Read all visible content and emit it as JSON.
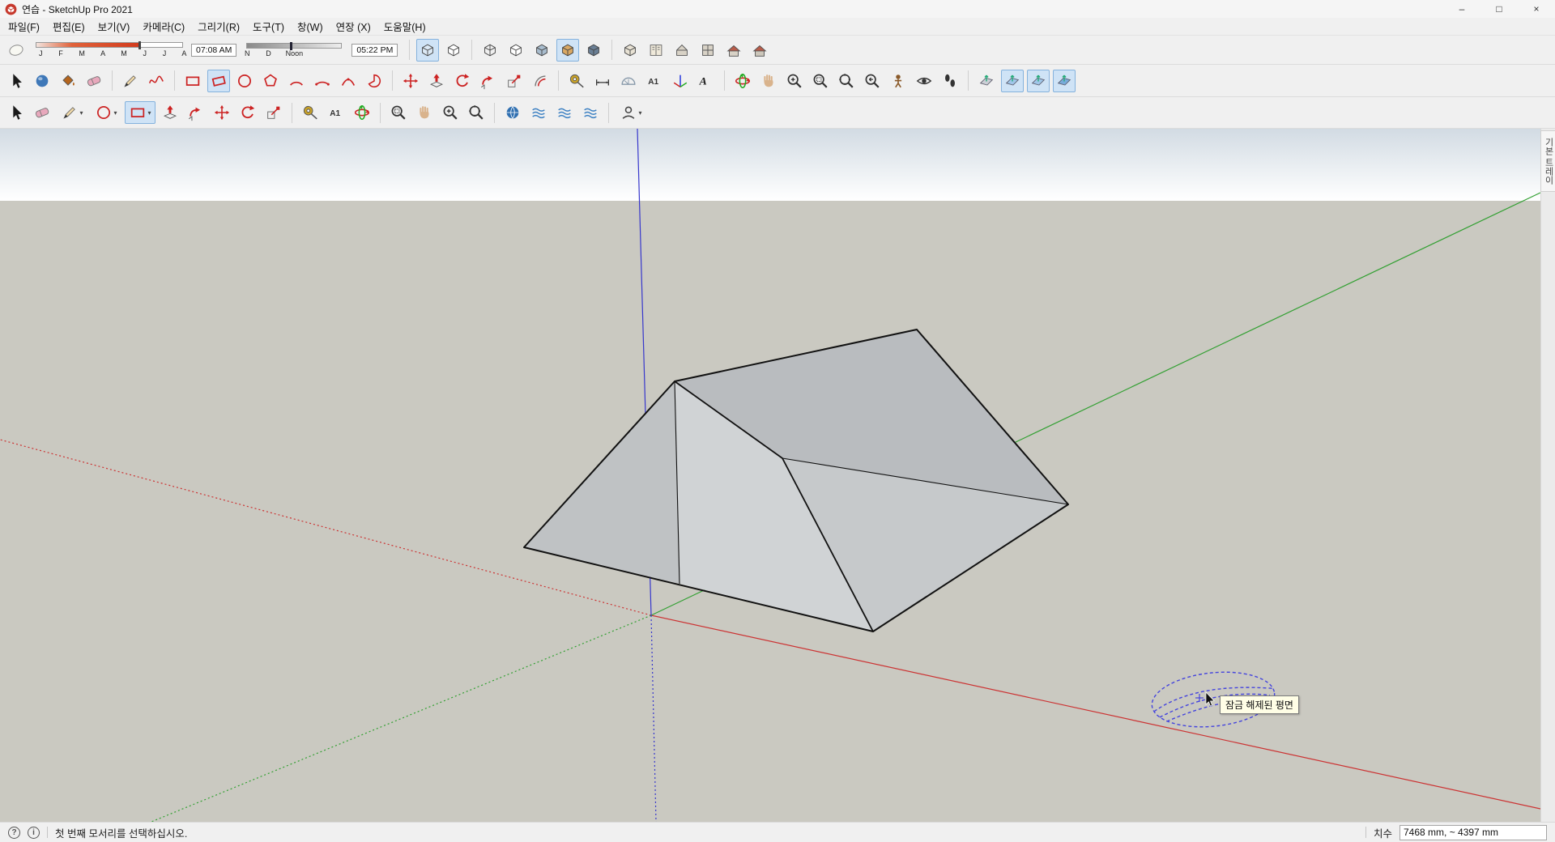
{
  "window": {
    "title": "연습 - SketchUp Pro 2021",
    "controls": {
      "minimize": "–",
      "maximize": "□",
      "close": "×"
    }
  },
  "menubar": {
    "items": [
      {
        "key": "file",
        "label": "파일(F)"
      },
      {
        "key": "edit",
        "label": "편집(E)"
      },
      {
        "key": "view",
        "label": "보기(V)"
      },
      {
        "key": "camera",
        "label": "카메라(C)"
      },
      {
        "key": "draw",
        "label": "그리기(R)"
      },
      {
        "key": "tools",
        "label": "도구(T)"
      },
      {
        "key": "window",
        "label": "창(W)"
      },
      {
        "key": "extensions",
        "label": "연장 (X)"
      },
      {
        "key": "help",
        "label": "도움말(H)"
      }
    ]
  },
  "shadow_toolbar": {
    "months_label": "J F M A M J J A S O N D",
    "time_start": "07:08 AM",
    "time_noon": "Noon",
    "time_end": "05:22 PM"
  },
  "toolbars": {
    "row1_left": [
      {
        "name": "shadow-toggle",
        "shape": "blob",
        "color": "#f8f8f2"
      }
    ],
    "row1_styles": [
      {
        "sep": true
      },
      {
        "name": "style-xray",
        "shape": "cube",
        "color": "#dce9f5",
        "active": true
      },
      {
        "name": "style-back-edges",
        "shape": "cube",
        "color": "#ffffff"
      },
      {
        "sep": true
      },
      {
        "name": "style-wireframe",
        "shape": "cubewire",
        "color": "#ffffff"
      },
      {
        "name": "style-hidden-line",
        "shape": "cube",
        "color": "#ffffff"
      },
      {
        "name": "style-shaded",
        "shape": "cube",
        "color": "#a8bccd"
      },
      {
        "name": "style-shaded-textures",
        "shape": "cube",
        "color": "#d9a864",
        "active": true
      },
      {
        "name": "style-monochrome",
        "shape": "cube",
        "color": "#6a7f95"
      },
      {
        "sep": true
      }
    ],
    "row1_views": [
      {
        "name": "scene-box-icon",
        "shape": "cube",
        "color": "#e8e2d4"
      },
      {
        "name": "pages-icon",
        "shape": "book",
        "color": "#efe9da"
      },
      {
        "name": "view-iso",
        "shape": "house",
        "color": "#d8d2c6"
      },
      {
        "name": "view-top",
        "shape": "housetop",
        "color": "#d8d2c6"
      },
      {
        "name": "view-front",
        "shape": "housefront",
        "color": "#d8d2c6"
      },
      {
        "name": "view-back",
        "shape": "housefront",
        "color": "#ccc6ba"
      }
    ],
    "row2": [
      {
        "name": "select-tool",
        "shape": "cursor",
        "color": "#1a1a1a"
      },
      {
        "name": "make-component-tool",
        "shape": "orb",
        "color": "#3f78b8"
      },
      {
        "name": "paint-bucket-tool",
        "shape": "bucket",
        "color": "#b5651d"
      },
      {
        "name": "eraser-tool",
        "shape": "eraser",
        "color": "#e8a8bc"
      },
      {
        "sep": true
      },
      {
        "name": "line-tool",
        "shape": "pencil",
        "color": "#333333"
      },
      {
        "name": "freehand-tool",
        "shape": "squiggle",
        "color": "#cc2222"
      },
      {
        "sep": true
      },
      {
        "name": "rectangle-tool",
        "shape": "rect",
        "color": "#cc2222"
      },
      {
        "name": "rotated-rectangle-tool",
        "shape": "rrect",
        "color": "#cc2222",
        "active": true
      },
      {
        "name": "circle-tool",
        "shape": "circle",
        "color": "#cc2222"
      },
      {
        "name": "polygon-tool",
        "shape": "polygon",
        "color": "#cc2222"
      },
      {
        "name": "arc-tool",
        "shape": "arc",
        "color": "#cc2222"
      },
      {
        "name": "two-point-arc-tool",
        "shape": "arc2",
        "color": "#cc2222"
      },
      {
        "name": "three-point-arc-tool",
        "shape": "arc3",
        "color": "#cc2222"
      },
      {
        "name": "pie-tool",
        "shape": "pie",
        "color": "#cc2222"
      },
      {
        "sep": true
      },
      {
        "name": "move-tool",
        "shape": "move",
        "color": "#cc2222"
      },
      {
        "name": "push-pull-tool",
        "shape": "pushpull",
        "color": "#cc2222"
      },
      {
        "name": "rotate-tool",
        "shape": "rotate",
        "color": "#cc2222"
      },
      {
        "name": "follow-me-tool",
        "shape": "followme",
        "color": "#cc2222"
      },
      {
        "name": "scale-tool",
        "shape": "scale",
        "color": "#cc2222"
      },
      {
        "name": "offset-tool",
        "shape": "offset",
        "color": "#cc2222"
      },
      {
        "sep": true
      },
      {
        "name": "tape-measure-tool",
        "shape": "tape",
        "color": "#c9a227"
      },
      {
        "name": "dimension-tool",
        "shape": "dim",
        "color": "#333333"
      },
      {
        "name": "protractor-tool",
        "shape": "protractor",
        "color": "#8899aa"
      },
      {
        "name": "text-tool",
        "shape": "textA",
        "color": "#333333"
      },
      {
        "name": "axes-tool",
        "shape": "axes",
        "color": "#cc2222"
      },
      {
        "name": "3d-text-tool",
        "shape": "text3d",
        "color": "#222222"
      },
      {
        "sep": true
      },
      {
        "name": "orbit-tool",
        "shape": "orbit",
        "color": "#cc2222"
      },
      {
        "name": "pan-tool",
        "shape": "hand",
        "color": "#d9b38c"
      },
      {
        "name": "zoom-tool",
        "shape": "zoomplus",
        "color": "#333333"
      },
      {
        "name": "zoom-window-tool",
        "shape": "zoomwin",
        "color": "#333333"
      },
      {
        "name": "zoom-extents-tool",
        "shape": "zoomext",
        "color": "#333333"
      },
      {
        "name": "previous-view-tool",
        "shape": "zoomprev",
        "color": "#333333"
      },
      {
        "name": "position-camera-tool",
        "shape": "poscam",
        "color": "#8a5a2a"
      },
      {
        "name": "look-around-tool",
        "shape": "eye",
        "color": "#333333"
      },
      {
        "name": "walk-tool",
        "shape": "feet",
        "color": "#333333"
      },
      {
        "sep": true
      },
      {
        "name": "section-plane-tool",
        "shape": "section",
        "color": "#c9ccd4"
      },
      {
        "name": "display-section-planes",
        "shape": "section",
        "color": "#9cc3e8",
        "active": true
      },
      {
        "name": "display-section-cuts",
        "shape": "section",
        "color": "#9cc3e8",
        "active": true
      },
      {
        "name": "display-section-fill",
        "shape": "section",
        "color": "#6fa6d8",
        "active": true
      }
    ],
    "row3": [
      {
        "name": "select-tool",
        "shape": "cursor",
        "color": "#1a1a1a"
      },
      {
        "name": "eraser-tool",
        "shape": "eraser",
        "color": "#e8a8bc"
      },
      {
        "name": "line-tool",
        "shape": "pencil",
        "color": "#333333",
        "dropdown": true
      },
      {
        "name": "circle-tool",
        "shape": "circle",
        "color": "#cc2222",
        "dropdown": true
      },
      {
        "name": "rectangle-tool",
        "shape": "rect",
        "color": "#cc2222",
        "active": true,
        "dropdown": true
      },
      {
        "name": "push-pull-tool",
        "shape": "pushpull",
        "color": "#cc2222"
      },
      {
        "name": "follow-me-tool",
        "shape": "followme",
        "color": "#cc2222"
      },
      {
        "name": "move-tool",
        "shape": "move",
        "color": "#cc2222"
      },
      {
        "name": "rotate-tool",
        "shape": "rotate",
        "color": "#cc2222"
      },
      {
        "name": "scale-tool",
        "shape": "scale",
        "color": "#cc2222"
      },
      {
        "sep": true
      },
      {
        "name": "tape-measure-tool",
        "shape": "tape",
        "color": "#c9a227"
      },
      {
        "name": "text-tool",
        "shape": "textA",
        "color": "#333333"
      },
      {
        "name": "orbit-tool",
        "shape": "orbit",
        "color": "#cc2222"
      },
      {
        "sep": true
      },
      {
        "name": "zoom-window-tool",
        "shape": "zoomwin",
        "color": "#333333"
      },
      {
        "name": "pan-tool",
        "shape": "hand",
        "color": "#d9b38c"
      },
      {
        "name": "zoom-tool",
        "shape": "zoomplus",
        "color": "#333333"
      },
      {
        "name": "zoom-extents-tool",
        "shape": "zoomext",
        "color": "#333333"
      },
      {
        "sep": true
      },
      {
        "name": "geo-location-icon",
        "shape": "globe",
        "color": "#2f6fb0"
      },
      {
        "name": "terrain-icon-1",
        "shape": "waves",
        "color": "#3a7fc2"
      },
      {
        "name": "terrain-icon-2",
        "shape": "waves",
        "color": "#3a7fc2"
      },
      {
        "name": "terrain-icon-3",
        "shape": "waves",
        "color": "#3a7fc2"
      },
      {
        "sep": true
      },
      {
        "name": "account-icon",
        "shape": "person",
        "color": "#444444",
        "dropdown": true
      }
    ]
  },
  "viewport": {
    "tooltip": "잠금 해제된 평면",
    "tray_tab": "기본 트레이",
    "colors": {
      "sky_top": "#d2dbe3",
      "ground": "#cac9c1",
      "axis_red": "#cc3333",
      "axis_green": "#33a033",
      "axis_blue": "#3636cc",
      "selection": "#4444dd"
    },
    "model": {
      "edge": "#111111",
      "face_top": "#b9bcbf",
      "face_right": "#c6c9cb",
      "face_left": "#bfc2c4",
      "face_front": "#d0d3d5"
    }
  },
  "statusbar": {
    "help_glyph": "?",
    "info_glyph": "i",
    "message": "첫 번째 모서리를 선택하십시오.",
    "dims_label": "치수",
    "dims_value": "7468 mm, ~ 4397 mm"
  }
}
